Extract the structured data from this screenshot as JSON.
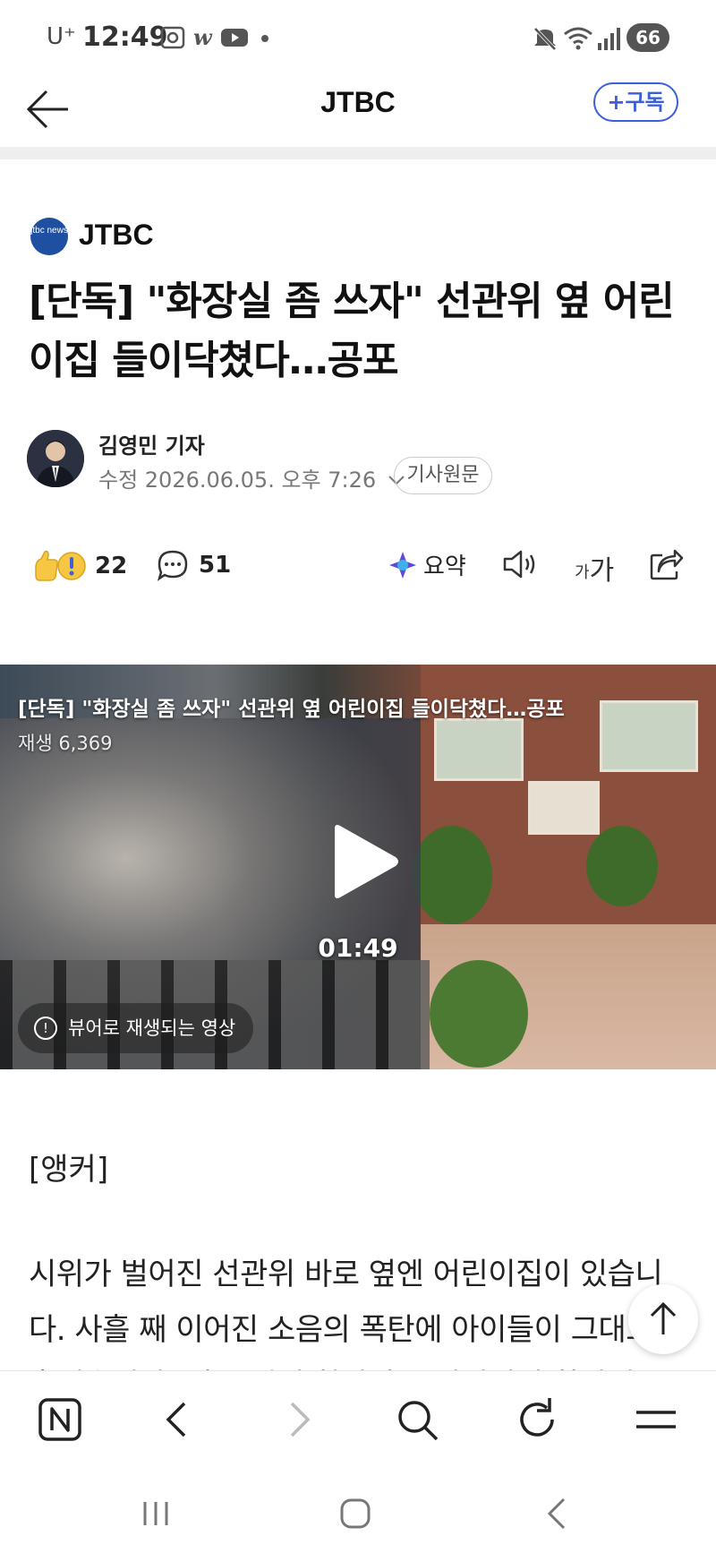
{
  "status_bar": {
    "carrier": "U⁺",
    "time": "12:49",
    "battery": "66"
  },
  "header": {
    "title": "JTBC",
    "subscribe_label": "+구독"
  },
  "article": {
    "press_logo_text": "jtbc news",
    "press_name": "JTBC",
    "headline": "[단독] \"화장실 좀 쓰자\" 선관위 옆 어린이집 들이닥쳤다…공포",
    "reporter": "김영민 기자",
    "date": "수정 2026.06.05. 오후 7:26",
    "original_button": "기사원문"
  },
  "actions": {
    "reaction_count": "22",
    "comment_count": "51",
    "summary_label": "요약",
    "font_label_small": "가",
    "font_label_large": "가"
  },
  "video": {
    "title": "[단독] \"화장실 좀 쓰자\" 선관위 옆 어린이집 들이닥쳤다…공포",
    "views": "재생 6,369",
    "duration": "01:49",
    "notice": "뷰어로 재생되는 영상"
  },
  "body": {
    "anchor": "[앵커]",
    "paragraph": "시위가 벌어진 선관위 바로 옆엔 어린이집이 있습니다. 사흘 째 이어진 소음의 폭탄에 아이들이 그대로 노출됐습니다. 일부 시위 참가자는 어린이집 화장실"
  },
  "colors": {
    "accent": "#3a5fd9",
    "divider": "#eeeeee"
  }
}
